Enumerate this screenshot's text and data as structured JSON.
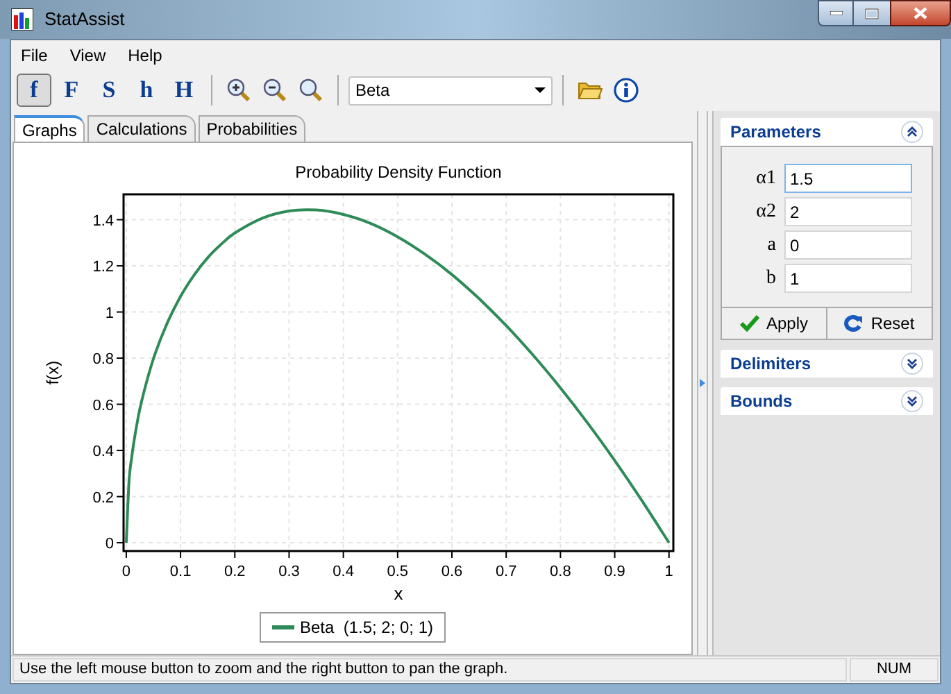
{
  "window": {
    "title": "StatAssist"
  },
  "menu": [
    "File",
    "View",
    "Help"
  ],
  "toolbar": {
    "modes": [
      {
        "label": "f",
        "selected": true
      },
      {
        "label": "F",
        "selected": false
      },
      {
        "label": "S",
        "selected": false
      },
      {
        "label": "h",
        "selected": false
      },
      {
        "label": "H",
        "selected": false
      }
    ],
    "distribution": "Beta"
  },
  "tabs": [
    {
      "label": "Graphs",
      "selected": true
    },
    {
      "label": "Calculations",
      "selected": false
    },
    {
      "label": "Probabilities",
      "selected": false
    }
  ],
  "chart": {
    "chart_data": {
      "type": "line",
      "title": "Probability Density Function",
      "xlabel": "x",
      "ylabel": "f(x)",
      "grid": true,
      "x": [
        0,
        0.005,
        0.01,
        0.02,
        0.03,
        0.05,
        0.075,
        0.1,
        0.125,
        0.15,
        0.175,
        0.2,
        0.25,
        0.3,
        0.35,
        0.4,
        0.45,
        0.5,
        0.55,
        0.6,
        0.65,
        0.7,
        0.75,
        0.8,
        0.85,
        0.9,
        0.95,
        1
      ],
      "series": [
        {
          "name": "Beta  (1.5; 2; 0; 1)",
          "color": "#2e8b57",
          "values": [
            0,
            0.264,
            0.371,
            0.52,
            0.63,
            0.797,
            0.95,
            1.067,
            1.16,
            1.235,
            1.294,
            1.342,
            1.406,
            1.438,
            1.442,
            1.423,
            1.384,
            1.326,
            1.251,
            1.162,
            1.058,
            0.941,
            0.812,
            0.671,
            0.519,
            0.356,
            0.183,
            0
          ]
        }
      ],
      "xlim": [
        -0.005,
        1.008
      ],
      "ylim": [
        -0.036,
        1.51
      ],
      "xticks": [
        0,
        0.1,
        0.2,
        0.3,
        0.4,
        0.5,
        0.6,
        0.7,
        0.8,
        0.9,
        1
      ],
      "yticks": [
        0,
        0.2,
        0.4,
        0.6,
        0.8,
        1,
        1.2,
        1.4
      ]
    }
  },
  "panel": {
    "sections": [
      {
        "title": "Parameters",
        "expanded": true
      },
      {
        "title": "Delimiters",
        "expanded": false
      },
      {
        "title": "Bounds",
        "expanded": false
      }
    ],
    "parameters": [
      {
        "label": "α1",
        "value": "1.5"
      },
      {
        "label": "α2",
        "value": "2"
      },
      {
        "label": "a",
        "value": "0"
      },
      {
        "label": "b",
        "value": "1"
      }
    ],
    "buttons": [
      {
        "kind": "apply",
        "label": "Apply"
      },
      {
        "kind": "reset",
        "label": "Reset"
      }
    ]
  },
  "status_bar": {
    "message": "Use the left mouse button to zoom and the right button to pan the graph.",
    "indicator": "NUM"
  }
}
